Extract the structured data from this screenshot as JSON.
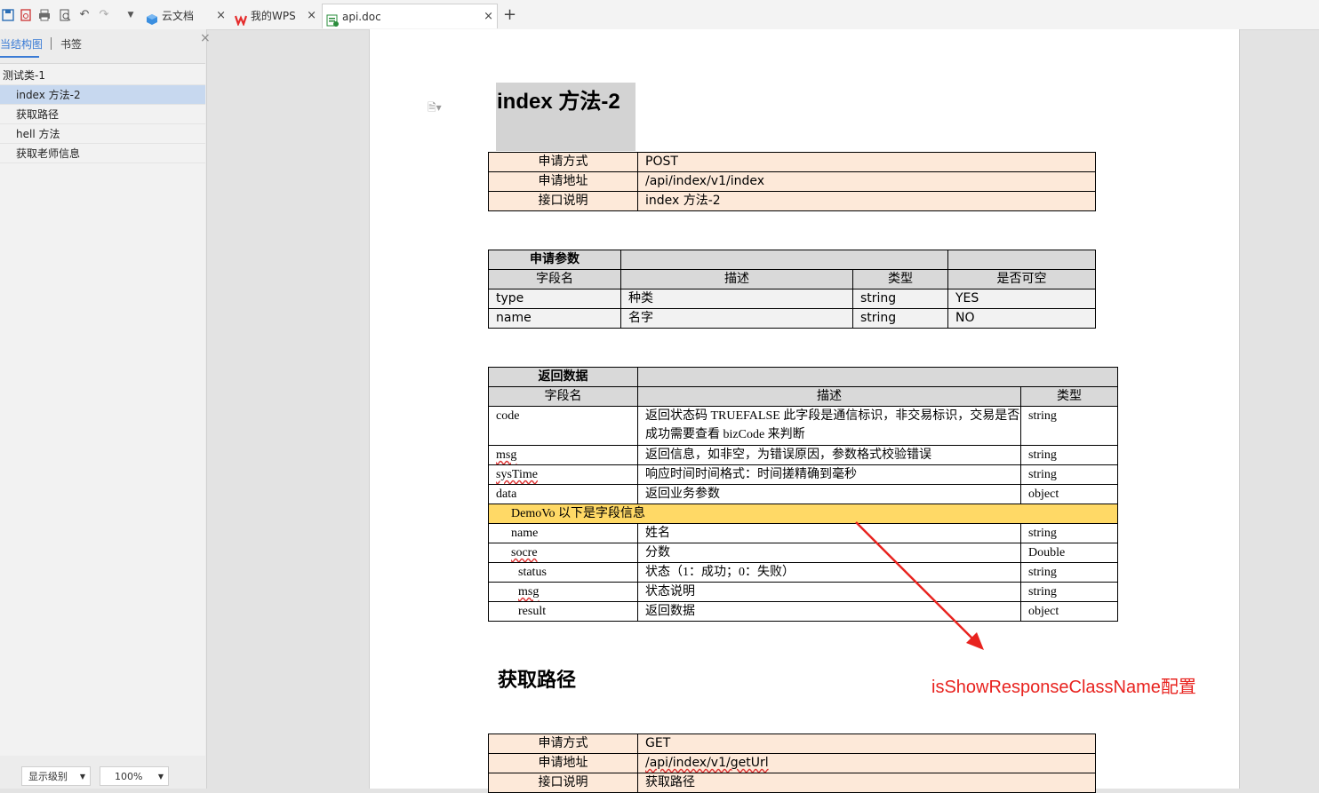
{
  "tabs": [
    {
      "label": "云文档",
      "icon": "cloud-cube-icon",
      "color": "#3b8fe0"
    },
    {
      "label": "我的WPS",
      "icon": "wps-logo-icon",
      "color": "#e52b2b"
    },
    {
      "label": "api.doc",
      "icon": "word-doc-icon",
      "color": "#2a8c3b",
      "active": true
    }
  ],
  "nav": {
    "tab_outline": "当结构图",
    "tab_bookmark": "书签",
    "items": [
      {
        "label": "测试类-1"
      },
      {
        "label": "index 方法-2",
        "selected": true
      },
      {
        "label": "获取路径"
      },
      {
        "label": "hell 方法"
      },
      {
        "label": "获取老师信息"
      }
    ],
    "level_label": "显示级别",
    "zoom": "100%"
  },
  "doc": {
    "heading1": "index 方法-2",
    "info_table": [
      {
        "label": "申请方式",
        "value": "POST"
      },
      {
        "label": "申请地址",
        "value": "/api/index/v1/index"
      },
      {
        "label": "接口说明",
        "value": "index 方法-2"
      }
    ],
    "params": {
      "title": "申请参数",
      "headers": [
        "字段名",
        "描述",
        "类型",
        "是否可空"
      ],
      "rows": [
        [
          "type",
          "种类",
          "string",
          "YES"
        ],
        [
          "name",
          "名字",
          "string",
          "NO"
        ]
      ]
    },
    "response": {
      "title": "返回数据",
      "headers": [
        "字段名",
        "描述",
        "类型"
      ],
      "rows": [
        [
          "code",
          "返回状态码 TRUEFALSE 此字段是通信标识，非交易标识，交易是否成功需要查看 bizCode 来判断",
          "string"
        ],
        [
          "msg",
          "返回信息，如非空，为错误原因，参数格式校验错误",
          "string"
        ],
        [
          "sysTime",
          "响应时间时间格式：时间搓精确到毫秒",
          "string"
        ],
        [
          "data",
          "返回业务参数",
          "object"
        ]
      ],
      "demo_label": "DemoVo 以下是字段信息",
      "demo_rows": [
        [
          "name",
          "姓名",
          "string"
        ],
        [
          "socre",
          "分数",
          "Double"
        ],
        [
          "status",
          "状态（1：成功；0：失败）",
          "string"
        ],
        [
          "msg",
          "状态说明",
          "string"
        ],
        [
          "result",
          "返回数据",
          "object"
        ]
      ]
    },
    "heading2": "获取路径",
    "info_table2": [
      {
        "label": "申请方式",
        "value": "GET"
      },
      {
        "label": "申请地址",
        "value": "/api/index/v1/getUrl"
      },
      {
        "label": "接口说明",
        "value": "获取路径"
      }
    ]
  },
  "annotation": {
    "text": "isShowResponseClassName配置",
    "color": "#e8231f"
  }
}
